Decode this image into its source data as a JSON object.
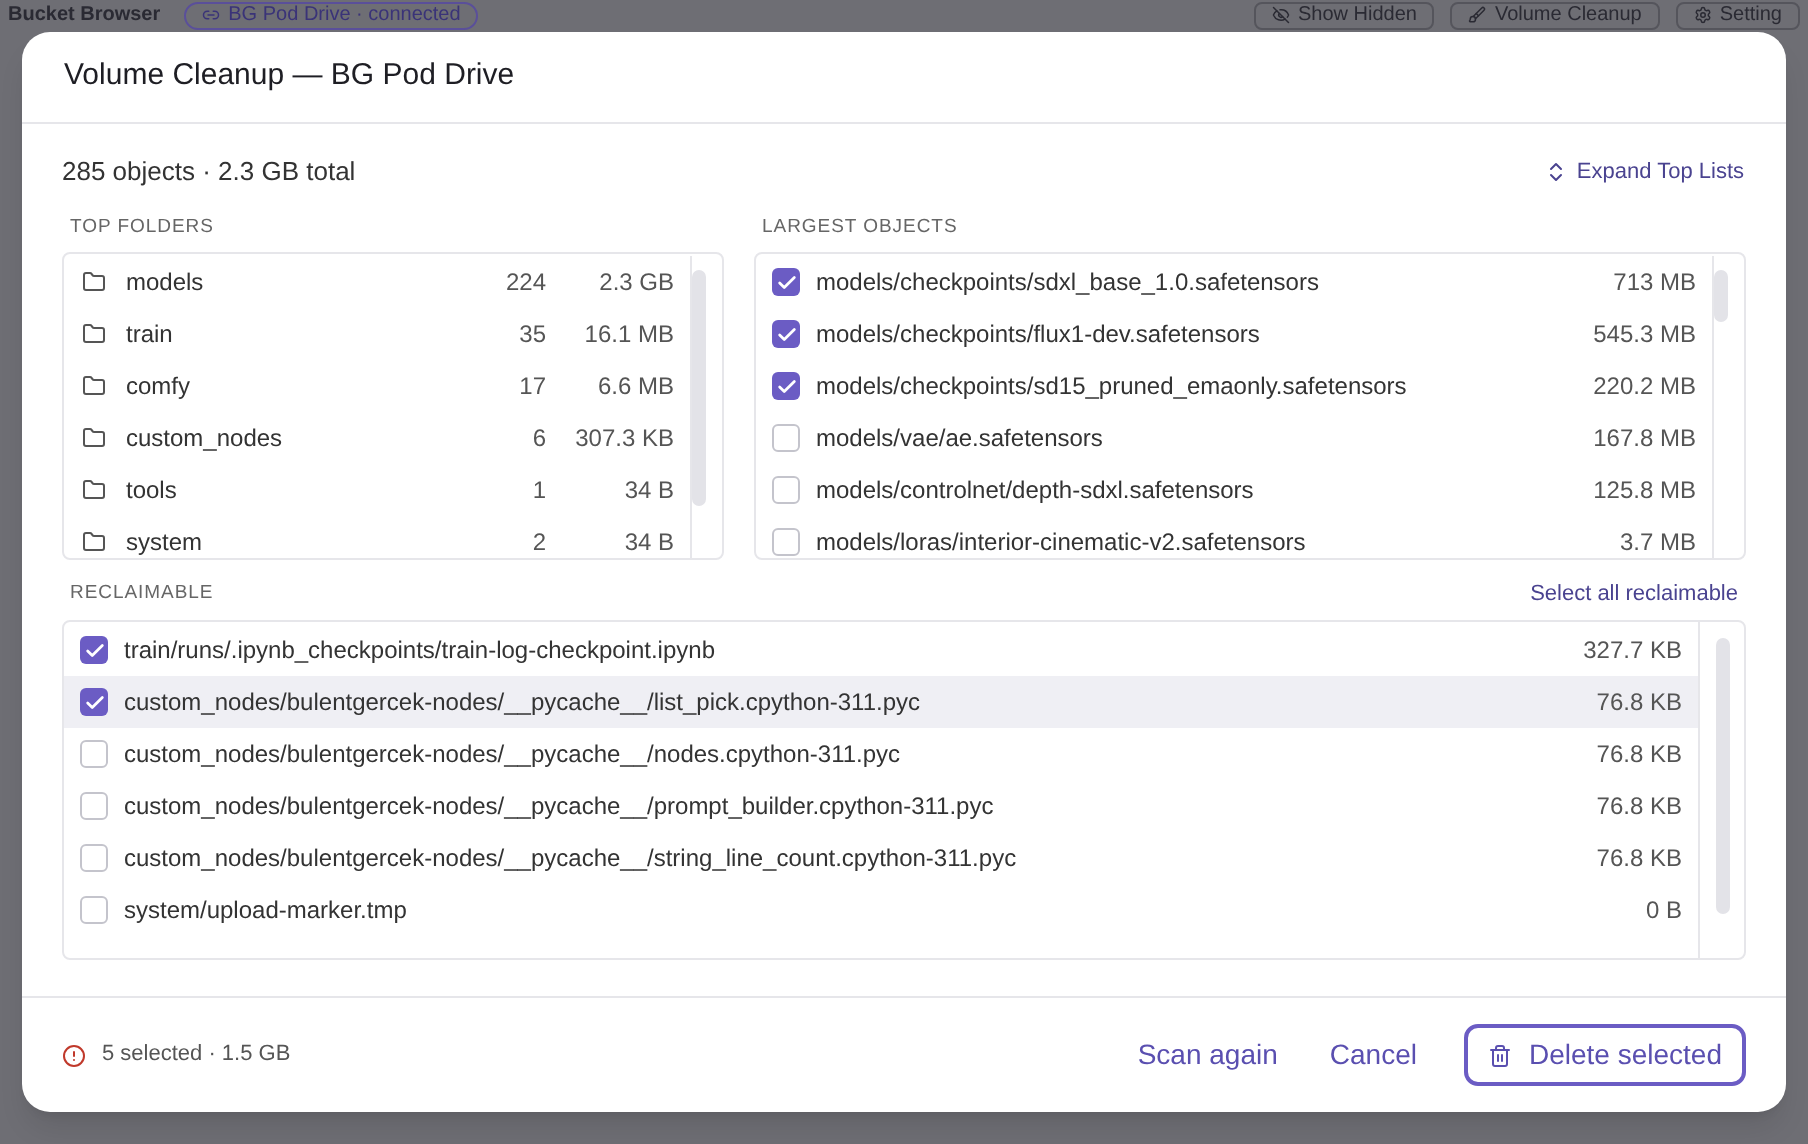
{
  "app_bar": {
    "title": "Bucket Browser",
    "connection": "BG Pod Drive · connected",
    "buttons": [
      "Show Hidden",
      "Volume Cleanup",
      "Setting"
    ]
  },
  "dialog": {
    "title": "Volume Cleanup — BG Pod Drive",
    "summary": "285 objects · 2.3 GB total",
    "expand_link": "Expand Top Lists",
    "top_folders": {
      "heading": "TOP FOLDERS",
      "rows": [
        {
          "name": "models",
          "count": "224",
          "size": "2.3 GB"
        },
        {
          "name": "train",
          "count": "35",
          "size": "16.1 MB"
        },
        {
          "name": "comfy",
          "count": "17",
          "size": "6.6 MB"
        },
        {
          "name": "custom_nodes",
          "count": "6",
          "size": "307.3 KB"
        },
        {
          "name": "tools",
          "count": "1",
          "size": "34 B"
        },
        {
          "name": "system",
          "count": "2",
          "size": "34 B"
        }
      ]
    },
    "largest_objects": {
      "heading": "LARGEST OBJECTS",
      "rows": [
        {
          "path": "models/checkpoints/sdxl_base_1.0.safetensors",
          "size": "713 MB",
          "checked": true
        },
        {
          "path": "models/checkpoints/flux1-dev.safetensors",
          "size": "545.3 MB",
          "checked": true
        },
        {
          "path": "models/checkpoints/sd15_pruned_emaonly.safetensors",
          "size": "220.2 MB",
          "checked": true
        },
        {
          "path": "models/vae/ae.safetensors",
          "size": "167.8 MB",
          "checked": false
        },
        {
          "path": "models/controlnet/depth-sdxl.safetensors",
          "size": "125.8 MB",
          "checked": false
        },
        {
          "path": "models/loras/interior-cinematic-v2.safetensors",
          "size": "3.7 MB",
          "checked": false
        }
      ]
    },
    "reclaimable": {
      "heading": "RECLAIMABLE",
      "select_all": "Select all reclaimable",
      "rows": [
        {
          "path": "train/runs/.ipynb_checkpoints/train-log-checkpoint.ipynb",
          "size": "327.7 KB",
          "checked": true,
          "selected": false
        },
        {
          "path": "custom_nodes/bulentgercek-nodes/__pycache__/list_pick.cpython-311.pyc",
          "size": "76.8 KB",
          "checked": true,
          "selected": true
        },
        {
          "path": "custom_nodes/bulentgercek-nodes/__pycache__/nodes.cpython-311.pyc",
          "size": "76.8 KB",
          "checked": false,
          "selected": false
        },
        {
          "path": "custom_nodes/bulentgercek-nodes/__pycache__/prompt_builder.cpython-311.pyc",
          "size": "76.8 KB",
          "checked": false,
          "selected": false
        },
        {
          "path": "custom_nodes/bulentgercek-nodes/__pycache__/string_line_count.cpython-311.pyc",
          "size": "76.8 KB",
          "checked": false,
          "selected": false
        },
        {
          "path": "system/upload-marker.tmp",
          "size": "0 B",
          "checked": false,
          "selected": false
        }
      ]
    },
    "footer": {
      "status": "5 selected · 1.5 GB",
      "buttons": [
        {
          "label": "Scan again",
          "kind": "text"
        },
        {
          "label": "Cancel",
          "kind": "text"
        },
        {
          "label": "Delete selected",
          "kind": "danger"
        }
      ]
    }
  }
}
